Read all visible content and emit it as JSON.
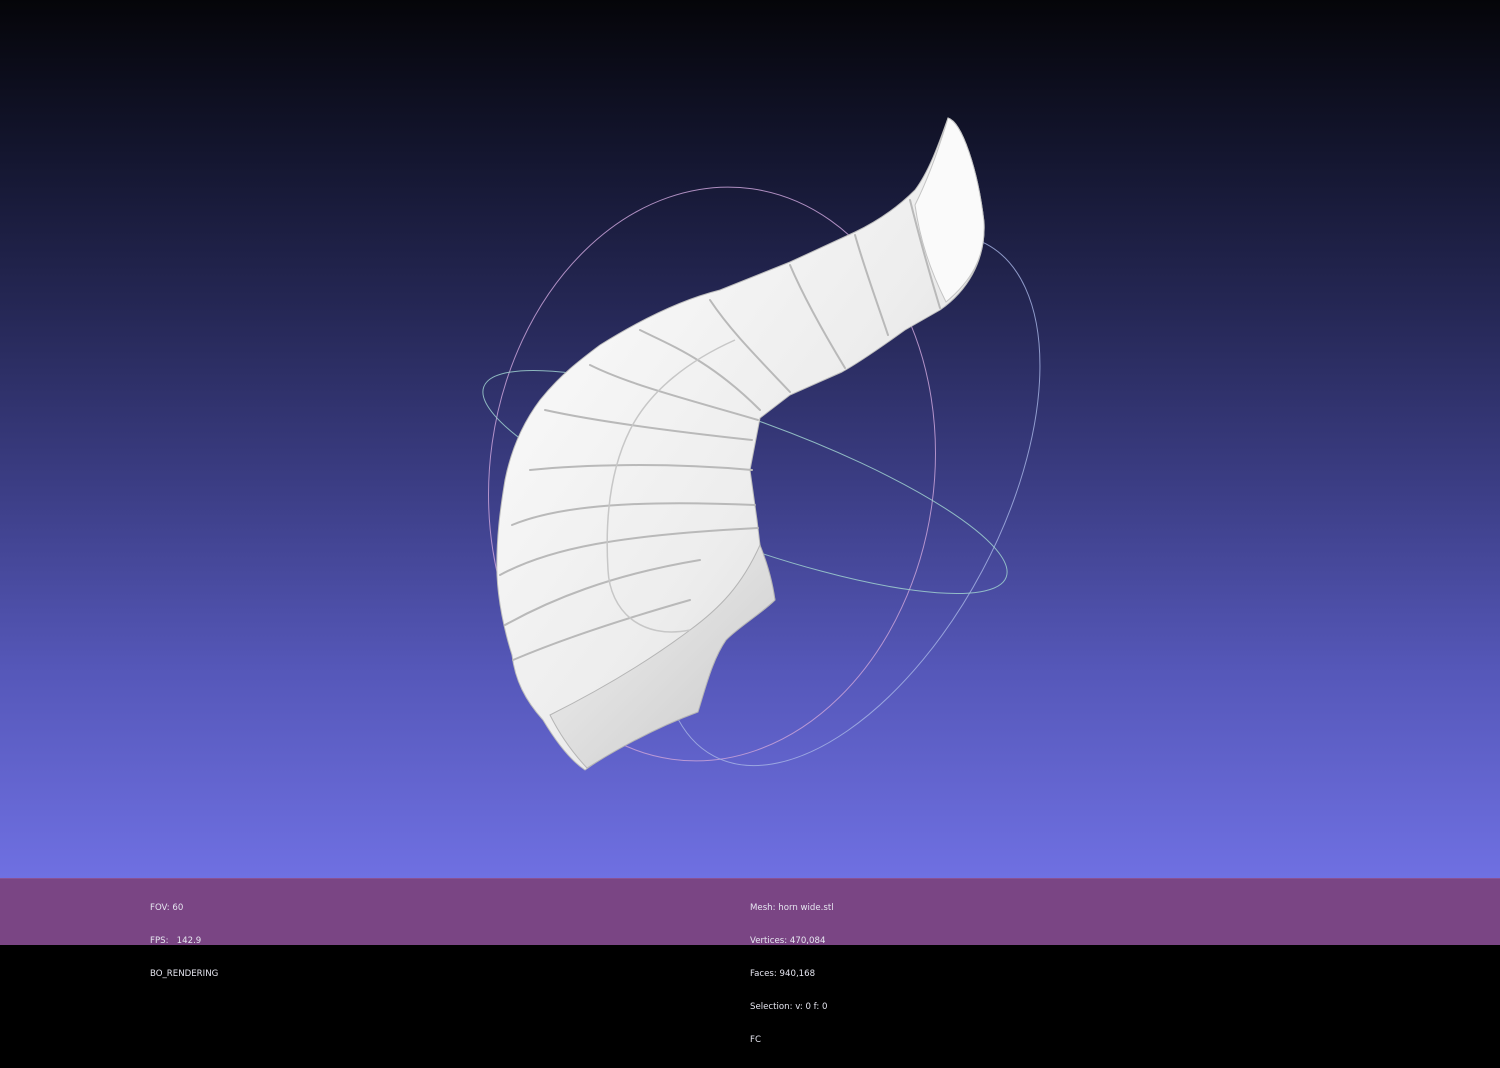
{
  "app": {
    "viewport_label": "3D mesh viewport",
    "colors": {
      "background_top": "#050509",
      "background_bottom": "#6f70e2",
      "statusbar": "#7a4584",
      "mesh": "#f2f2f2",
      "trackball_x": "#c9a2d8",
      "trackball_y": "#a9b6e6",
      "trackball_z": "#9fd0cf"
    },
    "icons": {
      "trackball": "trackball-gizmo-icon",
      "mesh": "horn-mesh-render"
    }
  },
  "statusbar": {
    "left": {
      "fov": "FOV: 60",
      "fps": "FPS:   142.9",
      "mode": "BO_RENDERING"
    },
    "right": {
      "mesh": "Mesh: horn wide.stl",
      "vertices": "Vertices: 470,084",
      "faces": "Faces: 940,168",
      "selection": "Selection: v: 0 f: 0",
      "flag": "FC"
    }
  }
}
